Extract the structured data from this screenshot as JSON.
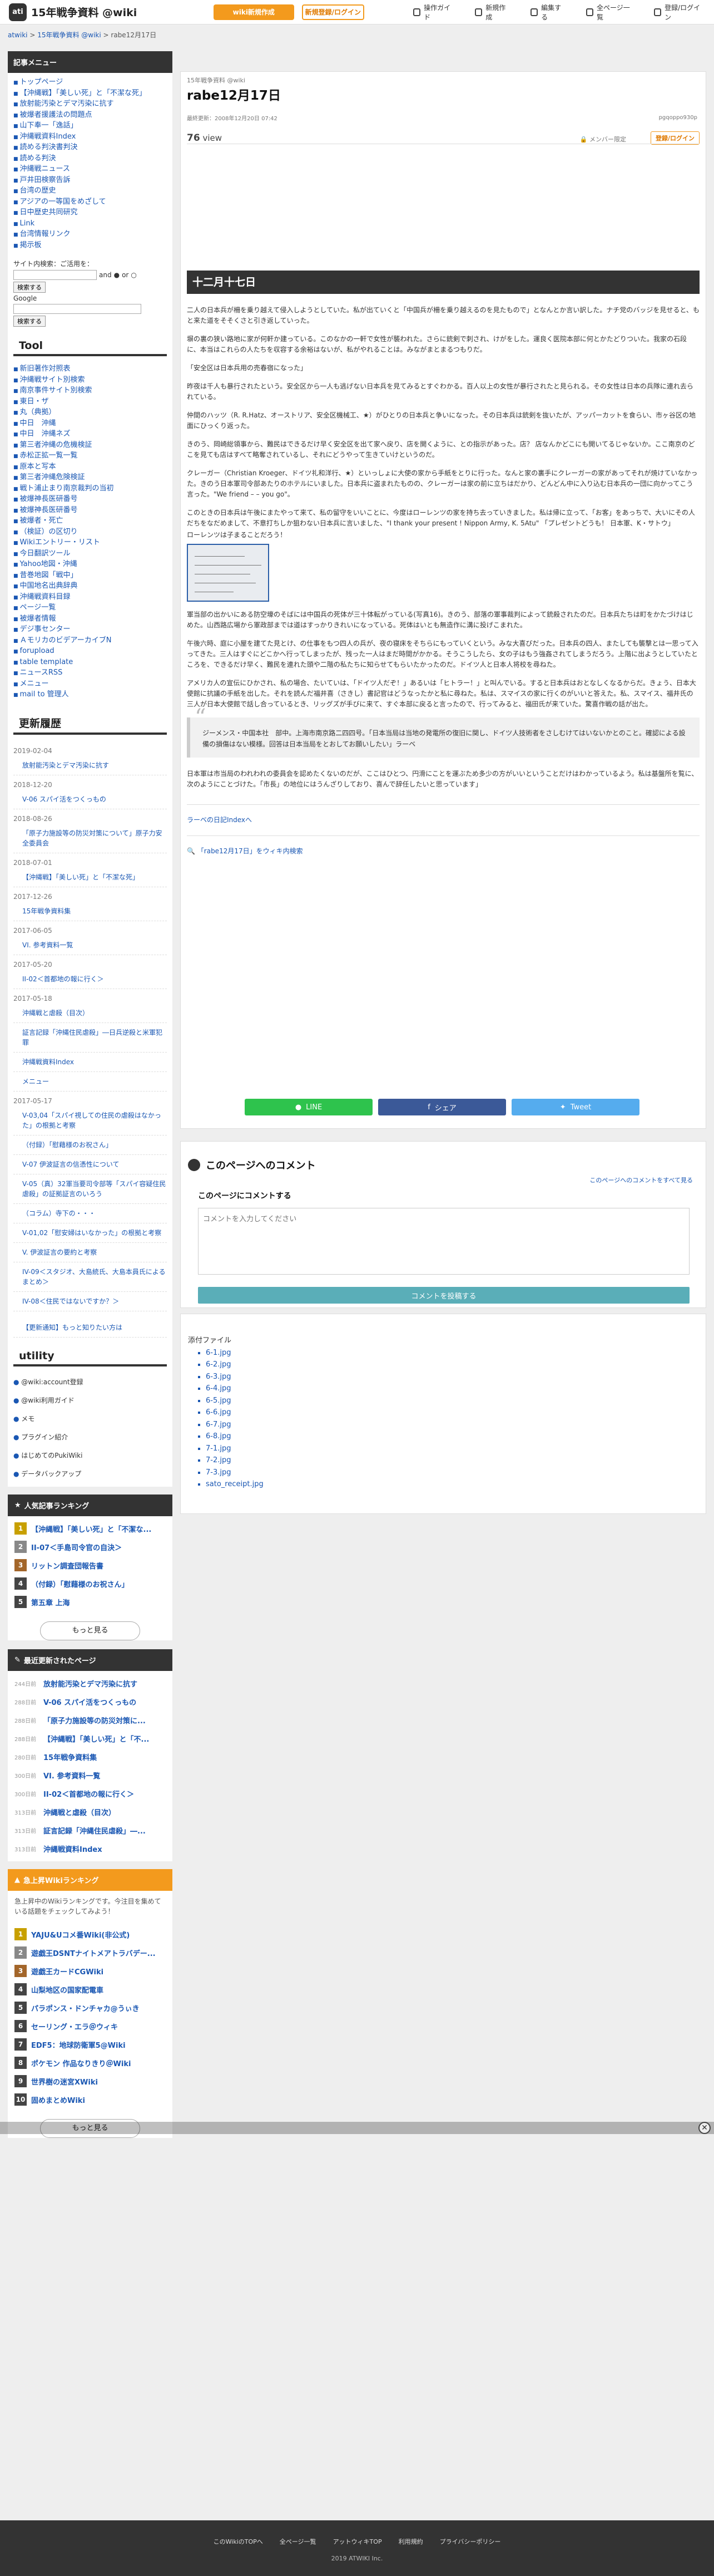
{
  "header": {
    "logo_badge": "ati",
    "site_title": "15年戦争資料 @wiki",
    "wiki_btn": "wiki新規作成",
    "login_btn": "新規登録/ログイン",
    "nav": [
      "操作ガイド",
      "新規作成",
      "編集する",
      "全ページ一覧",
      "登録/ログイン"
    ]
  },
  "breadcrumb": [
    "atwiki",
    "15年戦争資料 @wiki",
    "rabe12月17日"
  ],
  "sidebar": {
    "menu_title": "記事メニュー",
    "menu_items": [
      "トップページ",
      "【沖縄戦】「美しい死」と「不潔な死」",
      "放射能汚染とデマ汚染に抗す",
      "被爆者援護法の問題点",
      "山下奉一「逸話」",
      "沖縄戦資料Index",
      "読める判決書判決",
      "読める判決",
      "沖縄戦ニュース",
      "戸井田検察告訴",
      "台湾の歴史",
      "アジアの一等国をめざして",
      "日中歴史共同研究",
      "Link",
      "台湾情報リンク",
      "掲示板"
    ],
    "search_label": "サイト内検索：ご活用を：",
    "search_and": "and",
    "search_or": "or",
    "search_btn": "検索する",
    "google_label": "Google",
    "tool_title": "Tool",
    "tool_items": [
      "新旧著作対照表",
      "沖縄戦サイト別検索",
      "南京事件サイト別検索",
      "東日・ザ",
      "丸（典拠）",
      "中日　沖縄",
      "中日　沖縄ネズ",
      "第三者沖縄の危機検証",
      "赤松正拡一覧一覧",
      "原本と写本",
      "第三者沖縄危険検証",
      "戦ト浦止まり南京裁判の当初",
      "被爆神長医研番号",
      "被爆神長医研番号",
      "被爆者・死亡",
      "（検証）の区切り",
      "Wikiエントリー・リスト",
      "今日翻訳ツール",
      "Yahoo地図・沖縄",
      "昔巻地図「戦中」",
      "中国地名出典辞典",
      "沖縄戦資料目録",
      "ページ一覧",
      "被爆者情報",
      "デジ事センター",
      "ＡモリカのビデアーカイブN",
      "forupload",
      "table template",
      "ニュースRSS",
      "メニュー",
      "mail to 管理人"
    ],
    "recent_title": "更新履歴",
    "recent": [
      {
        "date": "2019-02-04",
        "entries": [
          "放射能汚染とデマ汚染に抗す"
        ]
      },
      {
        "date": "2018-12-20",
        "entries": [
          "V-06 スパイ活をつくっもの"
        ]
      },
      {
        "date": "2018-08-26",
        "entries": [
          "「原子力施設等の防災対策について」原子力安全委員会"
        ]
      },
      {
        "date": "2018-07-01",
        "entries": [
          "【沖縄戦】「美しい死」と「不潔な死」"
        ]
      },
      {
        "date": "2017-12-26",
        "entries": [
          "15年戦争資料集"
        ]
      },
      {
        "date": "2017-06-05",
        "entries": [
          "VI. 参考資料一覧"
        ]
      },
      {
        "date": "2017-05-20",
        "entries": [
          "II-02＜首都地の報に行く＞"
        ]
      },
      {
        "date": "2017-05-18",
        "entries": [
          "沖縄戦と虐殺（目次）",
          "証言記録「沖縄住民虐殺」―日兵逆殺と米軍犯罪",
          "沖縄戦資料Index",
          "メニュー"
        ]
      },
      {
        "date": "2017-05-17",
        "entries": [
          "V-03,04「スパイ視しての住民の虐殺はなかった」の根拠と考察",
          "（付録）「慰藉様のお祝さん」",
          "V-07 伊波証言の信憑性について",
          "V-05（真）32軍当要司令部等「スパイ容疑住民虐殺」の証拠証言のいろう",
          "（コラム）寺下の・・・",
          "V-01,02「慰安婦はいなかった」の根拠と考察",
          "V. 伊波証言の要約と考察",
          "IV-09＜スタジオ、大島統氏、大島本員氏によるまとめ＞",
          "IV-08＜住民ではないですか？＞"
        ]
      }
    ],
    "recent_more": "【更新通知】もっと知りたい方は",
    "utility_title": "utility",
    "utility": [
      "@wiki:account登録",
      "@wiki利用ガイド",
      "メモ",
      "プラグイン紹介",
      "はじめてのPukiWiki",
      "データバックアップ"
    ],
    "popular_title": "人気記事ランキング",
    "popular": [
      "【沖縄戦】「美しい死」と「不潔な...",
      "II-07＜手島司令官の自決＞",
      "リットン調査団報告書",
      "（付録）「慰藉様のお祝さん」",
      "第五章 上海"
    ],
    "more": "もっと見る",
    "updated_title": "最近更新されたページ",
    "updated": [
      {
        "t": "244日前",
        "l": "放射能汚染とデマ汚染に抗す"
      },
      {
        "t": "288日前",
        "l": "V-06 スパイ活をつくっもの"
      },
      {
        "t": "288日前",
        "l": "「原子力施設等の防災対策に..."
      },
      {
        "t": "288日前",
        "l": "【沖縄戦】「美しい死」と「不..."
      },
      {
        "t": "280日前",
        "l": "15年戦争資料集"
      },
      {
        "t": "300日前",
        "l": "VI. 参考資料一覧"
      },
      {
        "t": "300日前",
        "l": "II-02＜首都地の報に行く＞"
      },
      {
        "t": "313日前",
        "l": "沖縄戦と虐殺（目次）"
      },
      {
        "t": "313日前",
        "l": "証言記録「沖縄住民虐殺」―..."
      },
      {
        "t": "313日前",
        "l": "沖縄戦資料Index"
      }
    ],
    "rising_title": "急上昇Wikiランキング",
    "rising_info": "急上昇中のWikiランキングです。今注目を集めている話題をチェックしてみよう！",
    "rising": [
      "YAJU&Uコメ番Wiki(非公式)",
      "遊戯王DSNTナイトメアトラバデー...",
      "遊戯王カードCGWiki",
      "山梨地区の国家配電車",
      "パラポンス・ドンチャカ@うぃき",
      "セーリング・エラ＠ウィキ",
      "EDF5：地球防衛軍5@Wiki",
      "ポケモン 作品なりきり＠Wiki",
      "世界樹の迷宮XWiki",
      "固めまとめWiki"
    ]
  },
  "page": {
    "category": "15年戦争資料 @wiki",
    "title": "rabe12月17日",
    "meta": "最終更新：2008年12月20日 07:42",
    "author": "pgqoppo930p",
    "views_num": "76",
    "views_unit": "view",
    "member_note": "メンバー限定",
    "login_small": "登録/ログイン",
    "section_title": "十二月十七日",
    "para1": "二人の日本兵が柵を乗り越えて侵入しようとしていた。私が出ていくと「中国兵が柵を乗り越えるのを見たもので」となんとか言い訳した。ナチ党のバッジを見せると、もと来た道をそそくさと引き返していった。",
    "para2": "塀の裏の狭い路地に家が何軒か建っている。このなかの一軒で女性が襲われた。さらに銃剣で刺され、けがをした。運良く医院本部に何とかたどりついた。我家の石段に、本当はこれらの人たちを収容する余裕はないが、私がやれることは。みながまとまるつもりだ。",
    "para3": "「安全区は日本兵用の売春宿になった」",
    "para4": "昨夜は千人も暴行されたという。安全区から一人も逃げない日本兵を見てみるとすぐわかる。百人以上の女性が暴行されたと見られる。その女性は日本の兵隊に連れ去られている。",
    "para5": "仲間のハッツ（R. R.Hatz、オーストリア、安全区機械工、★）がひとりの日本兵と争いになった。その日本兵は銃剣を抜いたが、アッパーカットを食らい、市ヶ谷区の地面にひっくり返った。",
    "para6": "きのう、岡崎総領事から、難民はできるだけ早く安全区を出て家へ戻り、店を開くように、との指示があった。店？ 店なんかどこにも開いてるじゃないか。ここ南京のどこを見ても店はすべて略奪されているし、それにどうやって生きていけというのだ。",
    "para7": "クレーガー（Christian Kroeger、ドイツ礼和洋行、★）といっしょに大使の家から手紙をとりに行った。なんと家の裏手にクレーガーの家があってそれが焼けていなかった。きのう日本軍司令部あたりのホテルにいました。日本兵に盗まれたものの、クレーガーは家の前に立ちはだかり、どんどん中に入り込む日本兵の一団に向かってこう言った。\"We friend – – you go\"。",
    "para8": "このときの日本兵は午後にまたやって来て、私の留守をいいことに、今度はローレンツの家を持ち去っていきました。私は帰に立って、「お客」をあっちで、大いにその人だちをなだめまして、不意打ちしか狙わない日本兵に言いました、\"I thank your present ! Nippon Army, K. 5Atu\" 「プレゼントどうも！ 日本軍、K・サトウ」",
    "para8b": "ローレンツは子まることだろう！",
    "para9": "軍当部の出かいにある防空壕のそばには中国兵の死体が三十体転がっている(写真16)。きのう、部落の軍事裁判によって銃殺されたのだ。日本兵たちは町をかたづけはじめた。山西路広場から軍政部までは道はすっかりきれいになっている。死体はいとも無造作に溝に投げこまれた。",
    "para10": "午後六時、庭に小屋を建てた見とけ、の仕事をもつ四人の兵が、夜の寝床をそちらにもっていくという。みな大喜びだった。日本兵の四人、またしても襲撃とは一思って入ってきた。三人はすぐにどこかへ行ってしまったが、残った一人はまだ時間がかかる。そうこうしたら、女の子はもう強姦されてしまうだろう。上階に出ようとしていたところを、できるだけ早く、難民を連れた頭や二階の私たちに知らせてもらいたかったのだ。ドイツ人と日本人将校を尋ねた。",
    "para11": "アメリカ人の宣伝にひかされ、私の場合、たいていは、「ドイツ人だぞ！」あるいは「ヒトラー！」と叫んでいる。すると日本兵はおとなしくなるからだ。きょう、日本大使館に抗議の手紙を出した。それを読んだ福井喜（さきし）書記官はどうなったかと私に尋ねた。私は、スマイスの家に行くのがいいと答えた。私、スマイス、福井氏の三人が日本大使館で話し合っているとき、リッグズが手びに来て、すぐ本部に戻ると言ったので、行ってみると、福田氏が来ていた。驚喜作戦の話が出た。",
    "quote": "ジーメンス・中国本社　部中。上海市南京路二四四号。「日本当局は当地の発電所の復旧に関し、ドイツ人技術者をさしむけてはいないかとのこと。確認による設備の損傷はない模様。回答は日本当局をとおしてお願いしたい」ラーベ",
    "para12": "日本軍は市当局のわれわれの委員会を認めたくないのだが、ここはひとつ、円滑にことを運ぶため多少の方がいいということだけはわかっているよう。私は基盤所を覧に、次のようにことづけた。「市長」の地位にはうんざりしており、喜んで辞任したいと思っています」",
    "index_link": "ラーベの日記Indexへ",
    "search_link": "「rabe12月17日」をウィキ内検索",
    "line": "LINE",
    "fb": "シェア",
    "tw": "Tweet"
  },
  "comment": {
    "title": "このページへのコメント",
    "all_link": "このページへのコメントをすべて見る",
    "label": "このページにコメントする",
    "placeholder": "コメントを入力してください",
    "submit": "コメントを投稿する"
  },
  "attachments": {
    "title": "添付ファイル",
    "files": [
      "6-1.jpg",
      "6-2.jpg",
      "6-3.jpg",
      "6-4.jpg",
      "6-5.jpg",
      "6-6.jpg",
      "6-7.jpg",
      "6-8.jpg",
      "7-1.jpg",
      "7-2.jpg",
      "7-3.jpg",
      "sato_receipt.jpg"
    ]
  },
  "close_label": "✕",
  "footer": {
    "links": [
      "このWikiのTOPへ",
      "全ページ一覧",
      "アットウィキTOP",
      "利用規約",
      "プライバシーポリシー"
    ],
    "copy": "2019 ATWIKI Inc."
  }
}
